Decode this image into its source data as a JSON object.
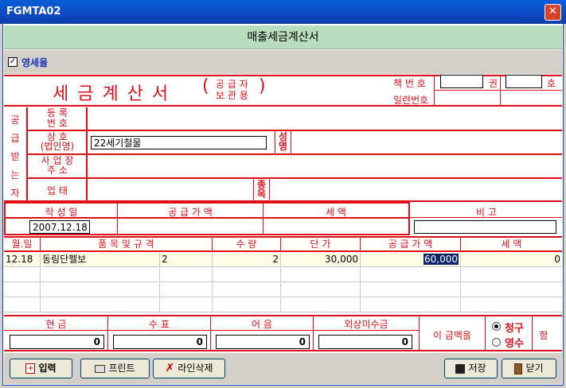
{
  "window": {
    "title": "FGMTA02",
    "close_glyph": "✕"
  },
  "header": {
    "title": "매출세금계산서"
  },
  "options": {
    "zero_rate_label": "영세율",
    "zero_rate_checked": true
  },
  "invoice": {
    "title": "세 금 계 산 서",
    "subtitle_top": "공 급 자",
    "subtitle_bottom": "보 관 용",
    "paren_open": "(",
    "paren_close": ")",
    "book_no_label": "책 번 호",
    "volume_label": "권",
    "number_label": "호",
    "serial_label": "일련번호",
    "book_volume": "",
    "book_number": ""
  },
  "buyer": {
    "section_label": [
      "공",
      "급",
      "받",
      "는",
      "자"
    ],
    "reg_no_label_1": "등   록",
    "reg_no_label_2": "번   호",
    "company_label_1": "상     호",
    "company_label_2": "(법인명)",
    "company_value": "22세기철물",
    "ceo_label_1": "성",
    "ceo_label_2": "명",
    "address_label_1": "사 업 장",
    "address_label_2": "주     소",
    "business_label": "업     태",
    "item_label_1": "종",
    "item_label_2": "목"
  },
  "summary": {
    "date_label": "작   성   일",
    "supply_label": "공   급   가   액",
    "tax_label": "세           액",
    "memo_label": "비           고",
    "date_value": "2007.12.18",
    "memo_value": ""
  },
  "grid": {
    "columns": [
      "월.일",
      "품 목 및 규 격",
      "수  량",
      "단  가",
      "공 급 가 액",
      "세     액"
    ],
    "rows": [
      {
        "date": "12.18",
        "item": "동링단펠보",
        "spec": "2",
        "qty": "2",
        "price": "30,000",
        "supply": "60,000",
        "tax": "0"
      }
    ]
  },
  "payment": {
    "cash_label": "현           금",
    "check_label": "수           표",
    "note_label": "어           음",
    "credit_label": "외상미수금",
    "cash_value": "0",
    "check_value": "0",
    "note_value": "0",
    "credit_value": "0",
    "amount_label": "이 금액을",
    "claim_label": "청구",
    "receipt_label": "영수",
    "suffix_label": "함",
    "selected": "claim"
  },
  "toolbar": {
    "input_label": "입력",
    "print_label": "프린트",
    "delete_line_label": "라인삭제",
    "save_label": "저장",
    "close_label": "닫기"
  },
  "colors": {
    "accent_red": "#e0101a",
    "header_green": "#b8dcbf",
    "title_blue": "#0b48c0",
    "selection_blue": "#0a246a"
  }
}
